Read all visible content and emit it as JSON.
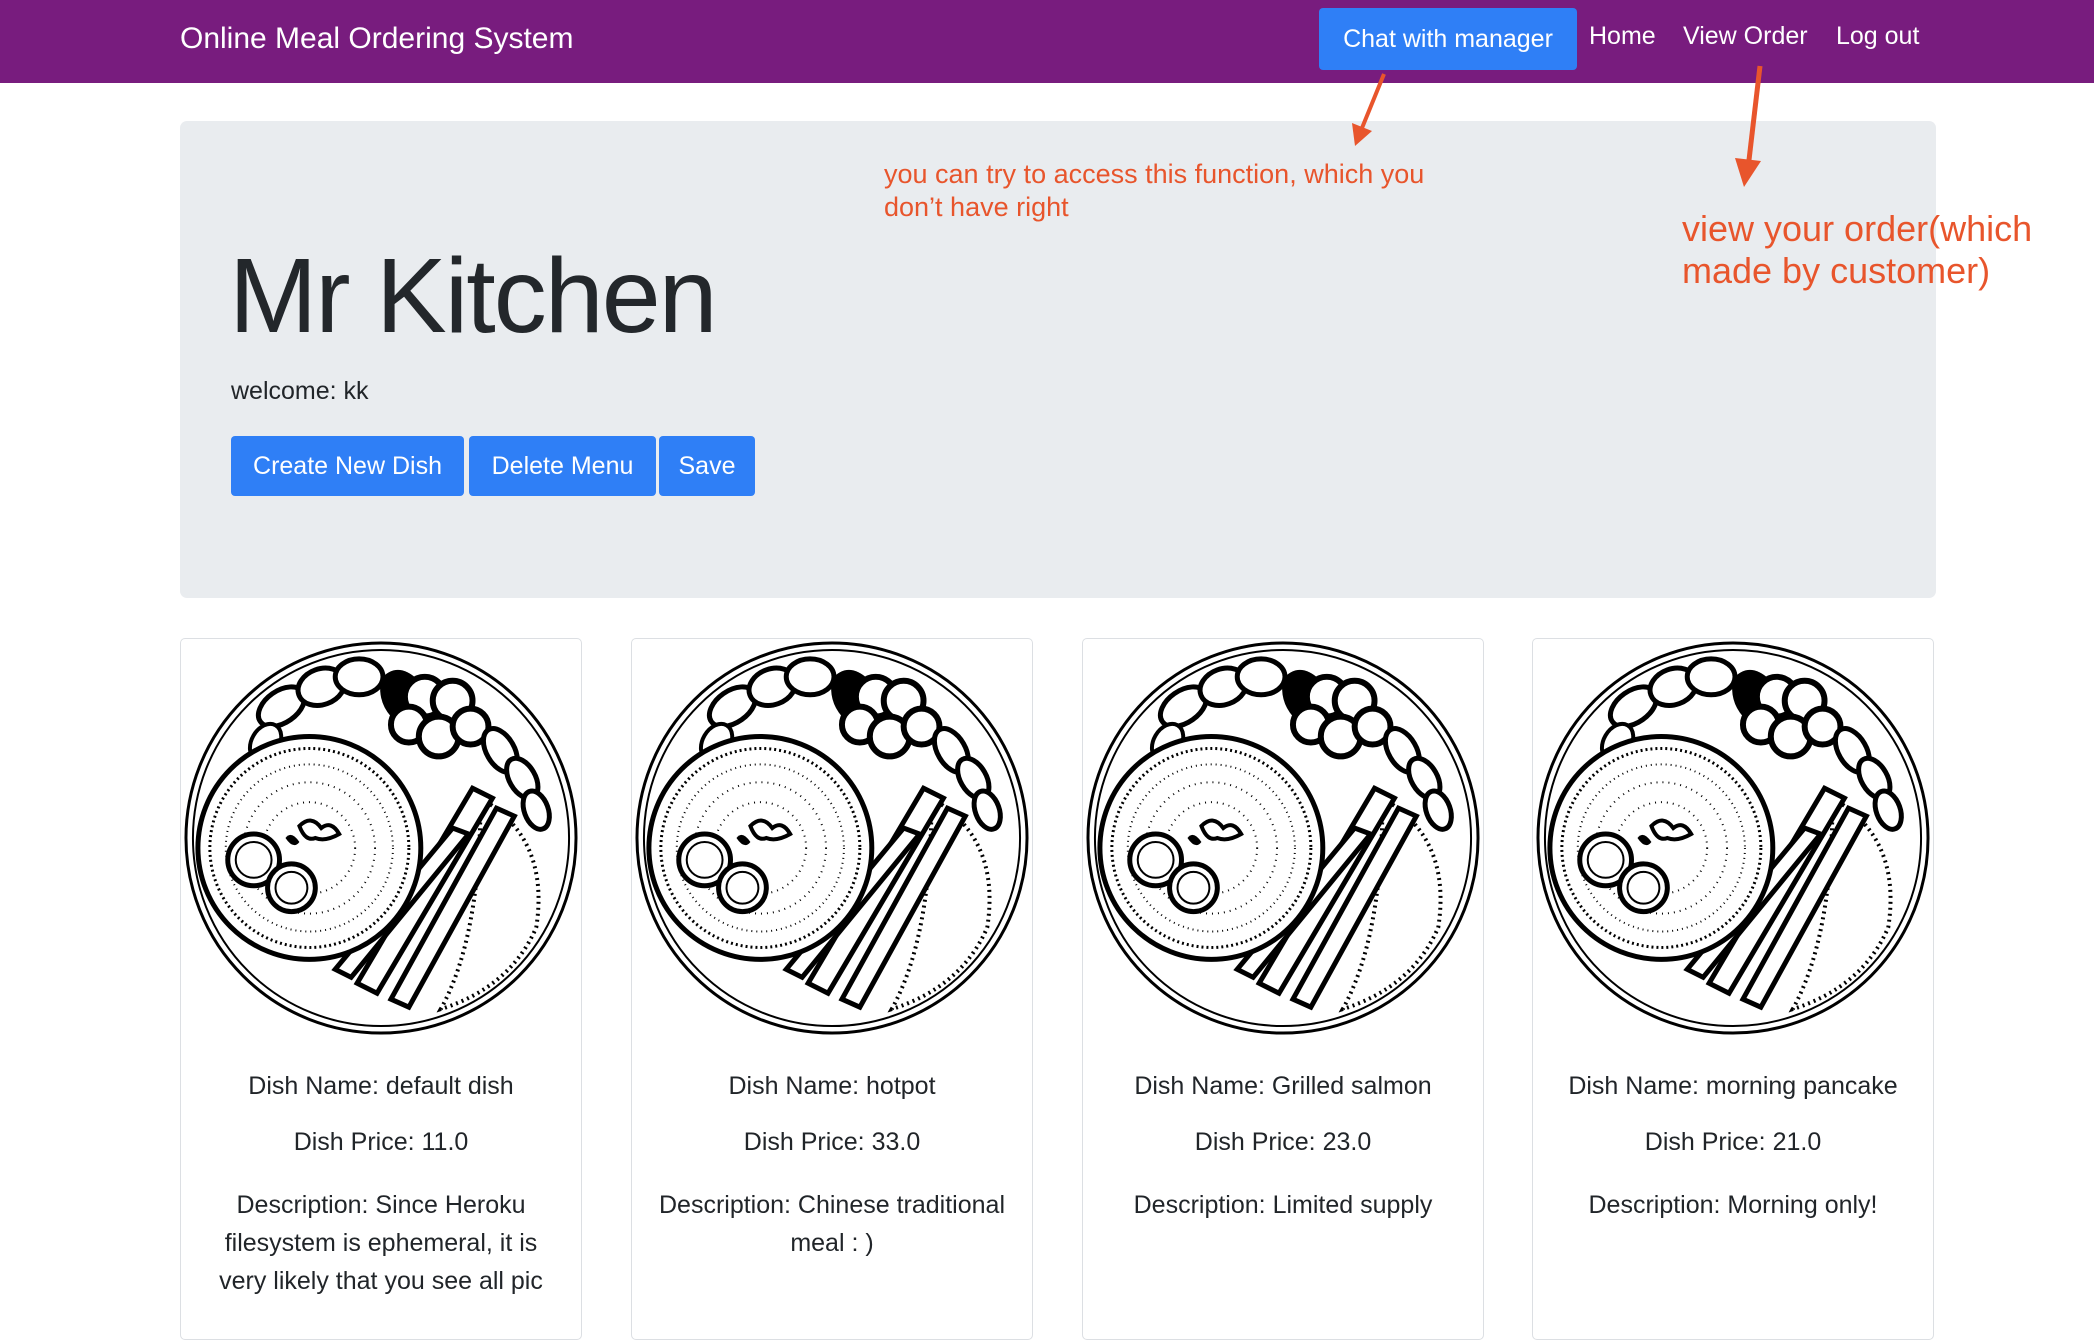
{
  "navbar": {
    "brand": "Online Meal Ordering System",
    "chat_label": "Chat with manager",
    "home_label": "Home",
    "view_order_label": "View Order",
    "logout_label": "Log out",
    "background_color": "#781c7e",
    "accent_color": "#2f7ff6"
  },
  "header": {
    "title": "Mr Kitchen",
    "welcome": "welcome: kk",
    "buttons": {
      "create": "Create New Dish",
      "delete": "Delete Menu",
      "save": "Save"
    }
  },
  "annotations": {
    "chat_note_line1": "you can try to access this function, which you",
    "chat_note_line2": "don’t have right",
    "order_note_line1": "view your order(which",
    "order_note_line2": "made by customer)",
    "color": "#e8552c"
  },
  "dishes": [
    {
      "name": "Dish Name: default dish",
      "price": "Dish Price: 11.0",
      "description": "Description: Since Heroku filesystem is ephemeral, it is very likely that you see all pic"
    },
    {
      "name": "Dish Name: hotpot",
      "price": "Dish Price: 33.0",
      "description": "Description: Chinese traditional meal : )"
    },
    {
      "name": "Dish Name: Grilled salmon",
      "price": "Dish Price: 23.0",
      "description": "Description: Limited supply"
    },
    {
      "name": "Dish Name: morning pancake",
      "price": "Dish Price: 21.0",
      "description": "Description: Morning only!"
    }
  ]
}
